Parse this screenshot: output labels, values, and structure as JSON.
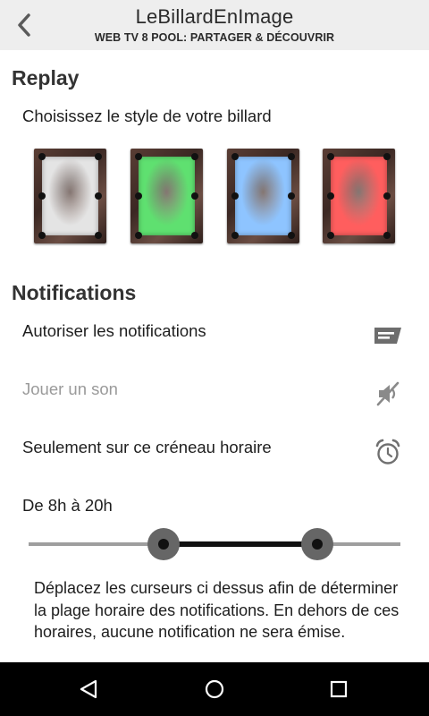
{
  "app_bar": {
    "title": "LeBillardEnImage",
    "subtitle": "WEB TV 8 POOL: PARTAGER & DÉCOUVRIR",
    "back_icon": "chevron-left-icon"
  },
  "replay": {
    "section_title": "Replay",
    "prompt": "Choisissez le style de votre billard",
    "tables": [
      {
        "name": "white",
        "felt_color": "#e4e4e4"
      },
      {
        "name": "green",
        "felt_color": "#5fe070"
      },
      {
        "name": "blue",
        "felt_color": "#8ec4ff"
      },
      {
        "name": "red",
        "felt_color": "#ff5e5e"
      }
    ]
  },
  "notifications": {
    "section_title": "Notifications",
    "allow": {
      "label": "Autoriser les notifications",
      "icon": "message-icon"
    },
    "sound": {
      "label": "Jouer un son",
      "icon": "sound-muted-icon",
      "disabled": true
    },
    "time_slot": {
      "label": "Seulement sur ce créneau horaire",
      "icon": "alarm-clock-icon"
    },
    "range_label": "De 8h à 20h",
    "range": {
      "min": 0,
      "max": 24,
      "start": 8,
      "end": 20
    },
    "help": "Déplacez les curseurs ci dessus afin de déterminer la plage horaire des notifications. En dehors de ces horaires, aucune notification ne sera émise."
  },
  "nav_bar": {
    "back_icon": "nav-back-icon",
    "home_icon": "nav-home-icon",
    "recents_icon": "nav-recents-icon"
  },
  "colors": {
    "app_bar_bg": "#eeeeee",
    "nav_bar_bg": "#000000",
    "slider_active": "#111111",
    "slider_inactive": "#9e9e9e",
    "slider_thumb": "#666666",
    "disabled_text": "#9a9a9a"
  }
}
